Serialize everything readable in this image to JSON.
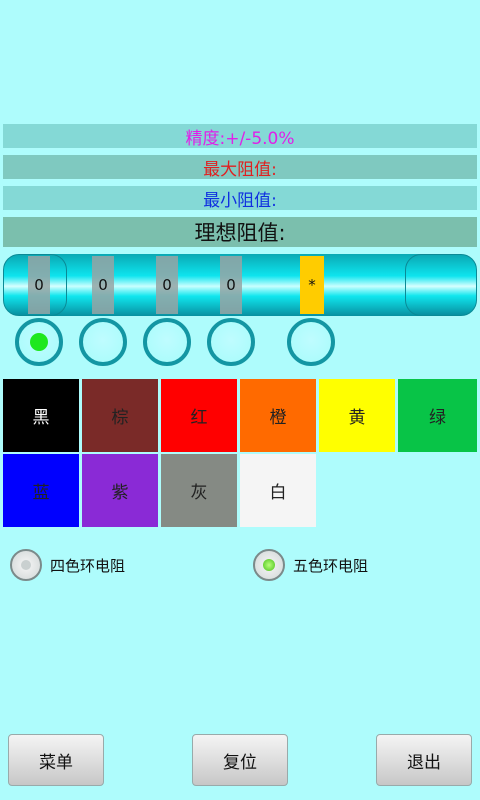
{
  "info": {
    "precision": "精度:+/-5.0%",
    "max_resistance": "最大阻值:",
    "min_resistance": "最小阻值:",
    "ideal_resistance": "理想阻值:"
  },
  "colors": {
    "precision_text": "#e020e8",
    "max_text": "#e02020",
    "min_text": "#1030e0"
  },
  "resistor": {
    "bands": [
      {
        "value": "0",
        "state": "grey"
      },
      {
        "value": "0",
        "state": "grey"
      },
      {
        "value": "0",
        "state": "grey"
      },
      {
        "value": "0",
        "state": "grey"
      },
      {
        "value": "*",
        "state": "selected",
        "color": "#ffcc00"
      }
    ],
    "band_selectors": [
      {
        "selected": true
      },
      {
        "selected": false
      },
      {
        "selected": false
      },
      {
        "selected": false
      },
      {
        "selected": false
      }
    ]
  },
  "color_palette": [
    {
      "label": "黑",
      "color": "#000000",
      "text_color": "#ffffff"
    },
    {
      "label": "棕",
      "color": "#7a2a28",
      "text_color": "#222222"
    },
    {
      "label": "红",
      "color": "#ff0000",
      "text_color": "#222222"
    },
    {
      "label": "橙",
      "color": "#ff6a00",
      "text_color": "#222222"
    },
    {
      "label": "黄",
      "color": "#ffff00",
      "text_color": "#222222"
    },
    {
      "label": "绿",
      "color": "#08c447",
      "text_color": "#222222"
    },
    {
      "label": "蓝",
      "color": "#0000ff",
      "text_color": "#222222"
    },
    {
      "label": "紫",
      "color": "#8a2ad6",
      "text_color": "#222222"
    },
    {
      "label": "灰",
      "color": "#858a84",
      "text_color": "#222222"
    },
    {
      "label": "白",
      "color": "#f5f5f5",
      "text_color": "#222222"
    }
  ],
  "band_mode": {
    "four_band": {
      "label": "四色环电阻",
      "checked": false
    },
    "five_band": {
      "label": "五色环电阻",
      "checked": true
    }
  },
  "buttons": {
    "menu": "菜单",
    "reset": "复位",
    "exit": "退出"
  }
}
